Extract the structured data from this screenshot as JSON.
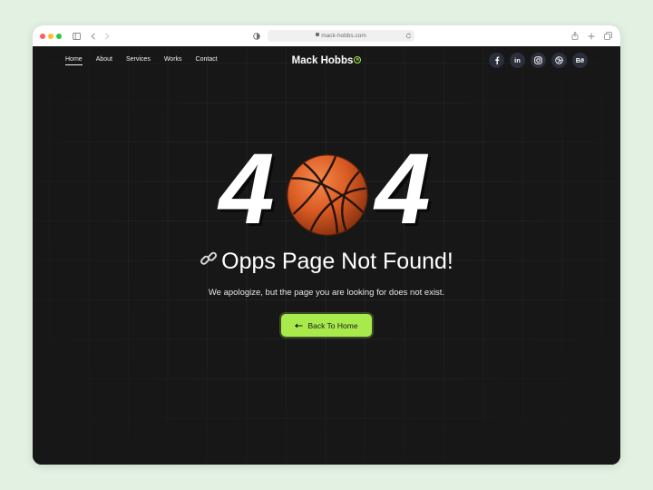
{
  "browser": {
    "url": "mack-hobbs.com"
  },
  "site": {
    "brand": "Mack Hobbs",
    "nav": [
      {
        "label": "Home",
        "active": true
      },
      {
        "label": "About",
        "active": false
      },
      {
        "label": "Services",
        "active": false
      },
      {
        "label": "Works",
        "active": false
      },
      {
        "label": "Contact",
        "active": false
      }
    ],
    "socials": [
      "facebook-icon",
      "linkedin-icon",
      "instagram-icon",
      "dribbble-icon",
      "behance-icon"
    ],
    "social_labels": {
      "linkedin": "in",
      "behance": "Bē"
    }
  },
  "hero": {
    "code_left": "4",
    "code_right": "4",
    "title": "Opps Page Not Found!",
    "message": "We apologize, but the page you are looking for does not exist.",
    "button_label": "Back To Home"
  },
  "colors": {
    "accent": "#a8ea4c",
    "background": "#171717",
    "outer_background": "#e3f1e3"
  }
}
